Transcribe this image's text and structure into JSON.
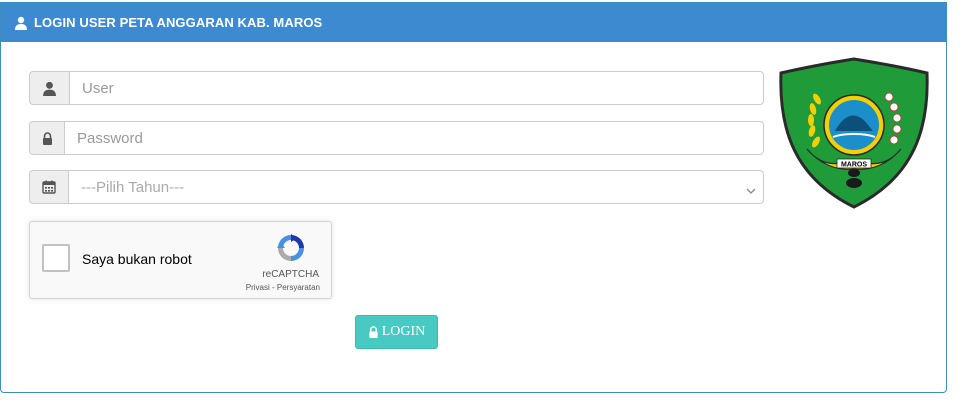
{
  "header": {
    "title": "LOGIN USER PETA ANGGARAN KAB. MAROS",
    "icon": "user-icon"
  },
  "form": {
    "user": {
      "placeholder": "User",
      "value": "",
      "icon": "user-icon"
    },
    "password": {
      "placeholder": "Password",
      "value": "",
      "icon": "lock-icon"
    },
    "year": {
      "selected": "---Pilih Tahun---",
      "icon": "calendar-icon"
    }
  },
  "recaptcha": {
    "label": "Saya bukan robot",
    "brand": "reCAPTCHA",
    "links": "Privasi - Persyaratan",
    "checked": false
  },
  "login": {
    "label": "LOGIN",
    "icon": "lock-icon"
  },
  "emblem": {
    "text": "MAROS"
  },
  "colors": {
    "header_bg": "#3d8ad0",
    "button_bg": "#48c9c2",
    "emblem_green": "#1f9b3a",
    "emblem_yellow": "#f3d000"
  }
}
